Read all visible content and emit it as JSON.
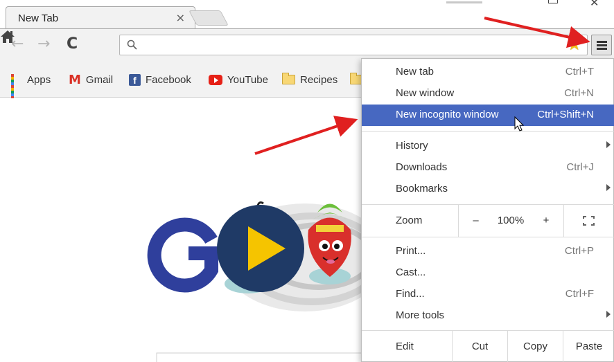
{
  "tab": {
    "title": "New Tab",
    "close": "×"
  },
  "toolbar": {
    "back": "←",
    "forward": "→",
    "reload": "C"
  },
  "bookmarks": [
    {
      "label": "Apps",
      "icon": "apps-icon"
    },
    {
      "label": "Gmail",
      "icon": "gmail-icon"
    },
    {
      "label": "Facebook",
      "icon": "facebook-icon"
    },
    {
      "label": "YouTube",
      "icon": "youtube-icon"
    },
    {
      "label": "Recipes",
      "icon": "folder-icon"
    }
  ],
  "menu": {
    "new_tab": {
      "label": "New tab",
      "shortcut": "Ctrl+T"
    },
    "new_window": {
      "label": "New window",
      "shortcut": "Ctrl+N"
    },
    "new_incognito": {
      "label": "New incognito window",
      "shortcut": "Ctrl+Shift+N"
    },
    "history": {
      "label": "History"
    },
    "downloads": {
      "label": "Downloads",
      "shortcut": "Ctrl+J"
    },
    "bookmarks": {
      "label": "Bookmarks"
    },
    "zoom": {
      "label": "Zoom",
      "minus": "–",
      "value": "100%",
      "plus": "+"
    },
    "print": {
      "label": "Print...",
      "shortcut": "Ctrl+P"
    },
    "cast": {
      "label": "Cast..."
    },
    "find": {
      "label": "Find...",
      "shortcut": "Ctrl+F"
    },
    "more_tools": {
      "label": "More tools"
    },
    "edit": {
      "label": "Edit",
      "cut": "Cut",
      "copy": "Copy",
      "paste": "Paste"
    }
  },
  "colors": {
    "highlight": "#4768c1",
    "arrow": "#e02020",
    "doodle_blue": "#1f3a66",
    "play": "#f5c400"
  }
}
